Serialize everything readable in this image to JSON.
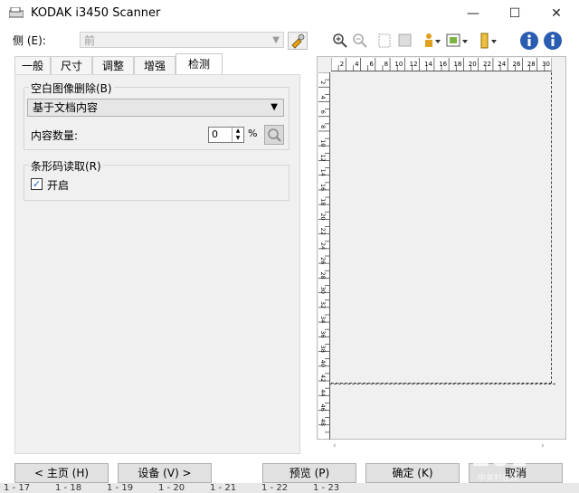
{
  "window": {
    "title": "KODAK i3450 Scanner",
    "minimize": "—",
    "maximize": "☐",
    "close": "✕"
  },
  "side": {
    "label": "侧 (E):",
    "value": "前"
  },
  "tabs": [
    "一般",
    "尺寸",
    "调整",
    "增强",
    "检测"
  ],
  "active_tab": "检测",
  "blank_image": {
    "legend": "空白图像删除(B)",
    "dropdown_value": "基于文档内容",
    "amount_label": "内容数量:",
    "amount_value": "0",
    "amount_unit": "%"
  },
  "barcode": {
    "legend": "条形码读取(R)",
    "checkbox_label": "开启",
    "checked": true
  },
  "ruler": {
    "top_ticks": [
      "2",
      "4",
      "6",
      "8",
      "10",
      "12",
      "14",
      "16",
      "18",
      "20",
      "22",
      "24",
      "26",
      "28",
      "30"
    ],
    "left_ticks": [
      "2",
      "4",
      "6",
      "8",
      "10",
      "12",
      "14",
      "16",
      "18",
      "20",
      "22",
      "24",
      "26",
      "28",
      "30",
      "32",
      "34",
      "36",
      "38",
      "40",
      "42",
      "44",
      "46",
      "48"
    ]
  },
  "buttons": {
    "home": "< 主页 (H)",
    "device": "设备 (V) >",
    "preview": "预览 (P)",
    "ok": "确定 (K)",
    "cancel": "取消"
  },
  "background_strip": [
    "1 - 17",
    "1 - 18",
    "1 - 19",
    "1 - 20",
    "1 - 21",
    "1 - 22",
    "1 - 23"
  ],
  "watermark": {
    "text": "ZOL",
    "sub": "中关村在线"
  }
}
